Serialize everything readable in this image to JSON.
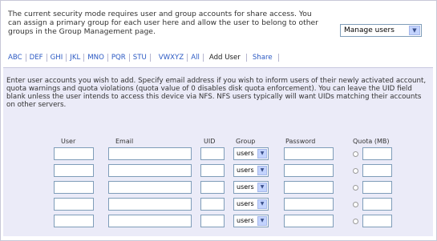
{
  "intro_text": "The current security mode requires user and group accounts for share access. You can assign a primary group for each user here and allow the user to belong to other groups in the Group Management page.",
  "manage_select": {
    "value": "Manage users"
  },
  "tabs": [
    {
      "label": "ABC"
    },
    {
      "label": "DEF"
    },
    {
      "label": "GHI"
    },
    {
      "label": "JKL"
    },
    {
      "label": "MNO"
    },
    {
      "label": "PQR"
    },
    {
      "label": "STU"
    },
    {
      "label": "VWXYZ"
    },
    {
      "label": "All"
    },
    {
      "label": "Add User"
    },
    {
      "label": "Share"
    }
  ],
  "description": "Enter user accounts you wish to add. Specify email address if you wish to inform users of their newly activated account, quota warnings and quota violations (quota value of 0 disables disk quota enforcement). You can leave the UID field blank unless the user intends to access this device via NFS. NFS users typically will want UIDs matching their accounts on other servers.",
  "columns": {
    "user": "User",
    "email": "Email",
    "uid": "UID",
    "group": "Group",
    "password": "Password",
    "quota": "Quota (MB)"
  },
  "rows": [
    {
      "group": "users"
    },
    {
      "group": "users"
    },
    {
      "group": "users"
    },
    {
      "group": "users"
    },
    {
      "group": "users"
    }
  ]
}
